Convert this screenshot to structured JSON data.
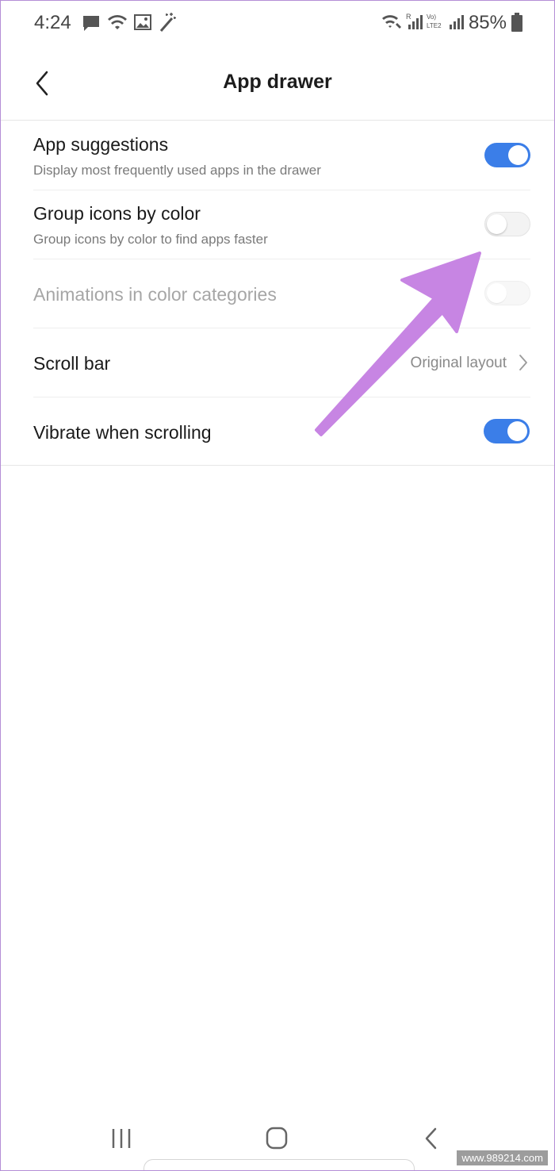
{
  "status_bar": {
    "time": "4:24",
    "battery": "85%"
  },
  "header": {
    "title": "App drawer"
  },
  "settings": [
    {
      "title": "App suggestions",
      "subtitle": "Display most frequently used apps in the drawer",
      "toggle": "on"
    },
    {
      "title": "Group icons by color",
      "subtitle": "Group icons by color to find apps faster",
      "toggle": "off"
    },
    {
      "title": "Animations in color categories",
      "toggle": "disabled"
    },
    {
      "title": "Scroll bar",
      "value": "Original layout"
    },
    {
      "title": "Vibrate when scrolling",
      "toggle": "on"
    }
  ],
  "colors": {
    "accent": "#3b7ee8",
    "annotation_arrow": "#c785e3"
  },
  "icons": [
    "message-icon",
    "wifi-icon",
    "image-icon",
    "magic-wand-icon",
    "wifi-calling-icon",
    "signal-icon",
    "volte-icon",
    "battery-icon",
    "back-arrow-icon",
    "chevron-right-icon",
    "recents-icon",
    "home-icon",
    "back-icon"
  ],
  "watermark": "www.989214.com"
}
